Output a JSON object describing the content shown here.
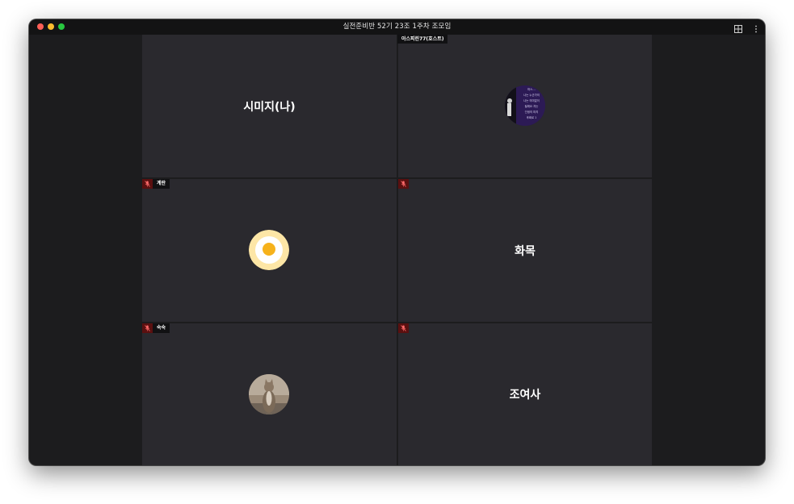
{
  "window": {
    "title": "실전준비반 52기 23조 1주차 조모임",
    "icons": {
      "layout": "grid-layout-icon",
      "more": "more-vertical-icon"
    }
  },
  "participants": [
    {
      "name": "시미지(나)",
      "display": "name"
    },
    {
      "name": "아스피린77(호스트)",
      "display": "avatar",
      "avatar_text": [
        "마스…",
        "나는 누군가의",
        "나는 의미없이",
        "될래요 자는",
        "인생의 마지",
        "후회로 1"
      ]
    },
    {
      "name": "계란",
      "display": "avatar",
      "muted": true,
      "icon": "fried-egg-avatar"
    },
    {
      "name": "화목",
      "display": "name",
      "muted": true
    },
    {
      "name": "숙숙",
      "display": "avatar",
      "muted": true,
      "icon": "cat-photo-avatar"
    },
    {
      "name": "조여사",
      "display": "name",
      "muted": true
    }
  ],
  "colors": {
    "tile_bg": "#2a292e",
    "window_bg": "#1c1c1e",
    "muted_mic": "#5a1010"
  }
}
